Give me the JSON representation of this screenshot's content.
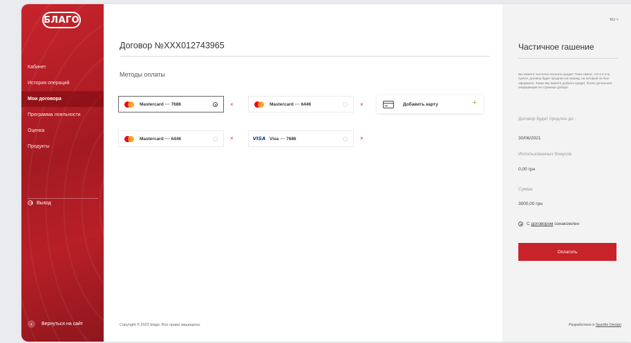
{
  "sidebar": {
    "logo": "БЛАГО",
    "items": [
      {
        "label": "Кабинет"
      },
      {
        "label": "История операций"
      },
      {
        "label": "Мои договора"
      },
      {
        "label": "Программа лояльности"
      },
      {
        "label": "Оценка"
      },
      {
        "label": "Продукты"
      }
    ],
    "logout_label": "Выход",
    "back_label": "Вернуться на сайт"
  },
  "main": {
    "contract_title": "Договор №XXX012743965",
    "methods_title": "Методы оплаты",
    "cards": [
      {
        "brand": "Mastercard",
        "label": "Mastercard ∙∙∙∙ 7686",
        "selected": true
      },
      {
        "brand": "Mastercard",
        "label": "Mastercard ∙∙∙∙ 6446",
        "selected": false
      },
      {
        "brand": "Mastercard",
        "label": "Mastercard ∙∙∙∙ 6446",
        "selected": false
      },
      {
        "brand": "Visa",
        "label": "Visa ∙∙∙∙ 7686",
        "selected": false
      }
    ],
    "visa_logo": "VISA",
    "remove_icon": "×",
    "add_card_label": "Добавить карту",
    "add_icon": "+",
    "copyright": "Copyright © 2022 blago. Все права защищены."
  },
  "panel": {
    "lang": "RU ˅",
    "title": "Частичное гашение",
    "description": "Вы можете частично погасить кредит. Тоже самое, что и в 2-м пункте, договор будет продлен на период, на который он был оформлен. Также Вы можете добрать кредит, более детальная информация на странице добора.",
    "extended_label": "Договор будет продлен до :",
    "extended_value": "30/06/2021",
    "bonuses_label": "Использованных бонусов",
    "bonuses_value": "0,00 грн",
    "sum_label": "Сумма",
    "sum_value": "3000,00 грн",
    "agree_prefix": "С ",
    "agree_link": "договором",
    "agree_suffix": " ознакомлен",
    "pay_button": "Оплатить",
    "credits_prefix": "Разработано в ",
    "credits_link": "Sparkle Design"
  },
  "colors": {
    "accent": "#c8232b",
    "plus": "#6fb82e"
  }
}
